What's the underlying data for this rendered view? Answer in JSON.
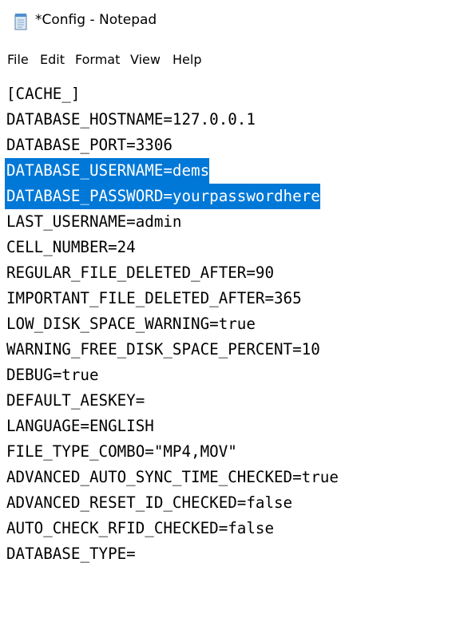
{
  "window": {
    "title": "*Config - Notepad"
  },
  "menu": [
    "File",
    "Edit",
    "Format",
    "View",
    "Help"
  ],
  "editor": {
    "lines": [
      "[CACHE_]",
      "DATABASE_HOSTNAME=127.0.0.1",
      "DATABASE_PORT=3306",
      "DATABASE_USERNAME=dems",
      "DATABASE_PASSWORD=yourpasswordhere",
      "LAST_USERNAME=admin",
      "CELL_NUMBER=24",
      "REGULAR_FILE_DELETED_AFTER=90",
      "IMPORTANT_FILE_DELETED_AFTER=365",
      "LOW_DISK_SPACE_WARNING=true",
      "WARNING_FREE_DISK_SPACE_PERCENT=10",
      "DEBUG=true",
      "DEFAULT_AESKEY=",
      "LANGUAGE=ENGLISH",
      "FILE_TYPE_COMBO=\"MP4,MOV\"",
      "ADVANCED_AUTO_SYNC_TIME_CHECKED=true",
      "ADVANCED_RESET_ID_CHECKED=false",
      "AUTO_CHECK_RFID_CHECKED=false",
      "DATABASE_TYPE="
    ],
    "selected_lines": [
      3,
      4
    ],
    "selection_color": "#0078d7"
  }
}
